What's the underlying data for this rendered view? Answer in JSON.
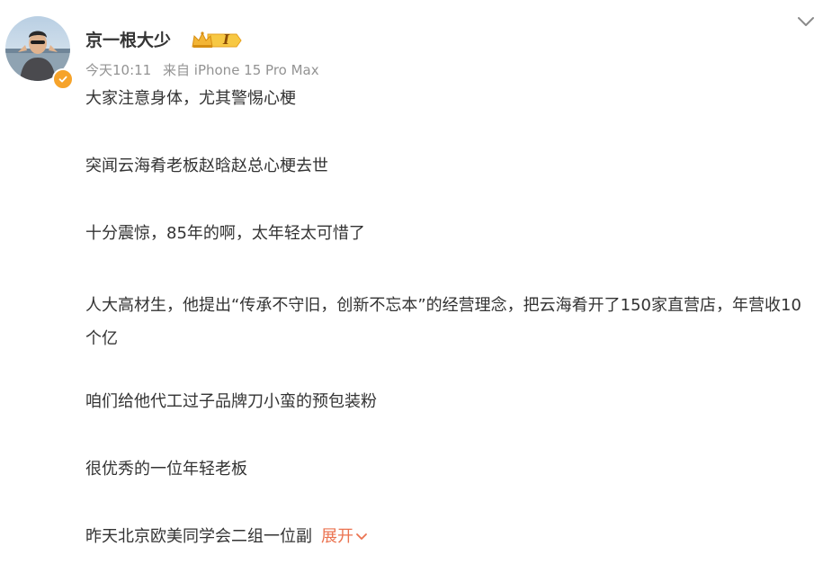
{
  "author": {
    "name": "京一根大少",
    "level": "I",
    "verified": true
  },
  "meta": {
    "time": "今天10:11",
    "source": "来自 iPhone 15 Pro Max"
  },
  "content": {
    "paragraphs": [
      "大家注意身体，尤其警惕心梗",
      "突闻云海肴老板赵晗赵总心梗去世",
      "十分震惊，85年的啊，太年轻太可惜了",
      "人大高材生，他提出“传承不守旧，创新不忘本”的经营理念，把云海肴开了150家直营店，年营收10个亿",
      "咱们给他代工过子品牌刀小蛮的预包装粉",
      "很优秀的一位年轻老板",
      "昨天北京欧美同学会二组一位副"
    ],
    "expand_label": "展开"
  },
  "colors": {
    "accent": "#eb7350",
    "verified": "#f6a32a",
    "meta_text": "#939393",
    "body_text": "#333333"
  },
  "icons": {
    "more": "chevron-down-icon",
    "verified": "verified-badge-icon",
    "level": "crown-level-icon"
  }
}
